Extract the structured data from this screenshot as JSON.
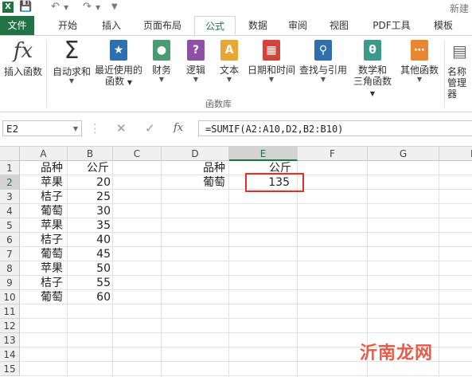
{
  "titlebar": {
    "app_icon": "X",
    "doc_title": "新建"
  },
  "tabs": [
    {
      "label": "文件"
    },
    {
      "label": "开始"
    },
    {
      "label": "插入"
    },
    {
      "label": "页面布局"
    },
    {
      "label": "公式"
    },
    {
      "label": "数据"
    },
    {
      "label": "审阅"
    },
    {
      "label": "视图"
    },
    {
      "label": "PDF工具"
    },
    {
      "label": "模板"
    }
  ],
  "ribbon": {
    "group_label": "函数库",
    "buttons": [
      {
        "label1": "插入函数",
        "label2": "",
        "icon": "fx-icon"
      },
      {
        "label1": "自动求和",
        "label2": "",
        "icon": "sigma-icon"
      },
      {
        "label1": "最近使用的",
        "label2": "函数",
        "icon": "star-book-icon"
      },
      {
        "label1": "财务",
        "label2": "",
        "icon": "coins-book-icon"
      },
      {
        "label1": "逻辑",
        "label2": "",
        "icon": "question-book-icon"
      },
      {
        "label1": "文本",
        "label2": "",
        "icon": "text-book-icon"
      },
      {
        "label1": "日期和时间",
        "label2": "",
        "icon": "calendar-book-icon"
      },
      {
        "label1": "查找与引用",
        "label2": "",
        "icon": "search-book-icon"
      },
      {
        "label1": "数学和",
        "label2": "三角函数",
        "icon": "theta-book-icon"
      },
      {
        "label1": "其他函数",
        "label2": "",
        "icon": "more-book-icon"
      },
      {
        "label1": "名称",
        "label2": "管理器",
        "icon": "name-manager-icon"
      }
    ]
  },
  "formula_bar": {
    "name_box": "E2",
    "formula": "=SUMIF(A2:A10,D2,B2:B10)"
  },
  "grid": {
    "columns": [
      "A",
      "B",
      "C",
      "D",
      "E",
      "F",
      "G",
      "H"
    ],
    "rows": [
      "1",
      "2",
      "3",
      "4",
      "5",
      "6",
      "7",
      "8",
      "9",
      "10",
      "11",
      "12",
      "13",
      "14",
      "15"
    ],
    "selected_col": "E",
    "selected_row": "2",
    "cells": {
      "A1": "品种",
      "B1": "公斤",
      "A2": "苹果",
      "B2": "20",
      "A3": "桔子",
      "B3": "25",
      "A4": "葡萄",
      "B4": "30",
      "A5": "苹果",
      "B5": "35",
      "A6": "桔子",
      "B6": "40",
      "A7": "葡萄",
      "B7": "45",
      "A8": "苹果",
      "B8": "50",
      "A9": "桔子",
      "B9": "55",
      "A10": "葡萄",
      "B10": "60",
      "D1": "品种",
      "E1": "公斤",
      "D2": "葡萄",
      "E2": "135"
    }
  },
  "watermark": "沂南龙网",
  "colors": {
    "accent": "#217346",
    "highlight": "#e0302a"
  }
}
